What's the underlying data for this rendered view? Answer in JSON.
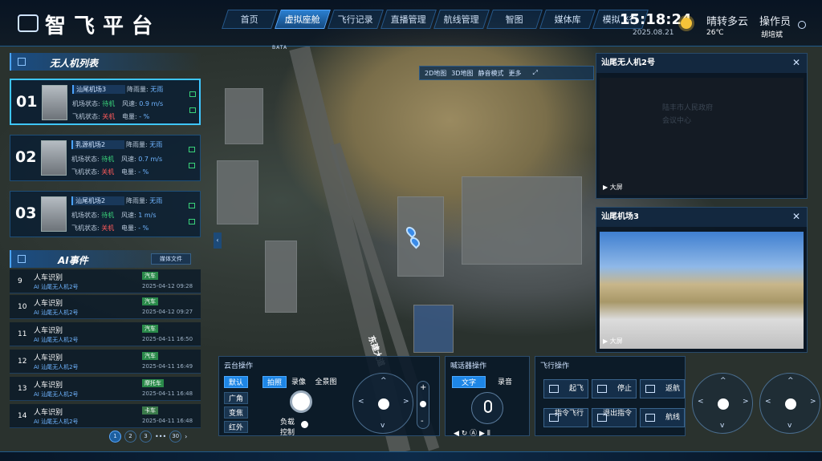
{
  "app": {
    "title": "智飞平台"
  },
  "nav": {
    "items": [
      "首页",
      "虚拟座舱",
      "飞行记录",
      "直播管理",
      "航线管理",
      "智图",
      "媒体库",
      "模拟飞行"
    ],
    "active": 1
  },
  "status": {
    "time": "15:18:24",
    "date": "2025.08.21",
    "weather": "晴转多云",
    "temp": "26℃",
    "operator_label": "操作员",
    "operator_name": "胡培斌"
  },
  "map": {
    "scale_label": "BATA",
    "toolbar": [
      "2D地图",
      "3D地图",
      "静音模式",
      "更多"
    ],
    "road_label": "东建大道"
  },
  "drones": {
    "title": "无人机列表",
    "items": [
      {
        "num": "01",
        "name": "汕尾机场3",
        "rain_label": "降雨量:",
        "rain": "无雨",
        "dock_label": "机场状态:",
        "dock": "待机",
        "wind_label": "风速:",
        "wind": "0.9 m/s",
        "uav_label": "飞机状态:",
        "uav": "关机",
        "power_label": "电量:",
        "power": "- %"
      },
      {
        "num": "02",
        "name": "乳源机场2",
        "rain_label": "降雨量:",
        "rain": "无雨",
        "dock_label": "机场状态:",
        "dock": "待机",
        "wind_label": "风速:",
        "wind": "0.7 m/s",
        "uav_label": "飞机状态:",
        "uav": "关机",
        "power_label": "电量:",
        "power": "- %"
      },
      {
        "num": "03",
        "name": "汕尾机场2",
        "rain_label": "降雨量:",
        "rain": "无雨",
        "dock_label": "机场状态:",
        "dock": "待机",
        "wind_label": "风速:",
        "wind": "1 m/s",
        "uav_label": "飞机状态:",
        "uav": "关机",
        "power_label": "电量:",
        "power": "- %"
      }
    ]
  },
  "ai": {
    "title": "AI事件",
    "media_button": "媒体文件",
    "events": [
      {
        "idx": "9",
        "title": "人车识别",
        "src": "AI 汕尾无人机2号",
        "tag": "汽车",
        "time": "2025-04-12 09:28"
      },
      {
        "idx": "10",
        "title": "人车识别",
        "src": "AI 汕尾无人机2号",
        "tag": "汽车",
        "time": "2025-04-12 09:27"
      },
      {
        "idx": "11",
        "title": "人车识别",
        "src": "AI 汕尾无人机2号",
        "tag": "汽车",
        "time": "2025-04-11 16:50"
      },
      {
        "idx": "12",
        "title": "人车识别",
        "src": "AI 汕尾无人机2号",
        "tag": "汽车",
        "time": "2025-04-11 16:49"
      },
      {
        "idx": "13",
        "title": "人车识别",
        "src": "AI 汕尾无人机2号",
        "tag": "摩托车",
        "time": "2025-04-11 16:48"
      },
      {
        "idx": "14",
        "title": "人车识别",
        "src": "AI 汕尾无人机2号",
        "tag": "卡车",
        "time": "2025-04-11 16:48"
      }
    ],
    "pager": [
      "1",
      "2",
      "3",
      "•••",
      "30"
    ]
  },
  "video1": {
    "title": "汕尾无人机2号",
    "overlay1": "陆丰市人民政府",
    "overlay2": "会议中心",
    "fullscreen": "大屏"
  },
  "video2": {
    "title": "汕尾机场3",
    "fullscreen": "大屏"
  },
  "gimbal": {
    "title": "云台操作",
    "modes": [
      "默认",
      "广角",
      "变焦",
      "红外"
    ],
    "capture": [
      "拍照",
      "录像",
      "全景图"
    ],
    "payload": "负载控制"
  },
  "speaker": {
    "title": "喊话器操作",
    "tabs": [
      "文字",
      "录音"
    ]
  },
  "flight": {
    "title": "飞行操作",
    "buttons": [
      "起飞",
      "停止",
      "返航",
      "指令飞行",
      "退出指令",
      "航线"
    ]
  },
  "colors": {
    "accent": "#1e86e6",
    "online": "#39d27a",
    "off": "#ff5a5a"
  }
}
